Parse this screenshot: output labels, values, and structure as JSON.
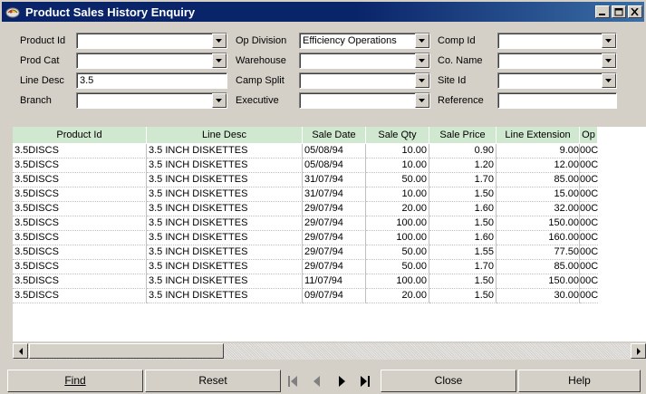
{
  "window": {
    "title": "Product Sales History Enquiry"
  },
  "form": {
    "product_id": {
      "label": "Product Id",
      "value": ""
    },
    "prod_cat": {
      "label": "Prod Cat",
      "value": ""
    },
    "line_desc": {
      "label": "Line Desc",
      "value": "3.5"
    },
    "branch": {
      "label": "Branch",
      "value": ""
    },
    "op_division": {
      "label": "Op Division",
      "value": "Efficiency Operations"
    },
    "warehouse": {
      "label": "Warehouse",
      "value": ""
    },
    "camp_split": {
      "label": "Camp Split",
      "value": ""
    },
    "executive": {
      "label": "Executive",
      "value": ""
    },
    "comp_id": {
      "label": "Comp Id",
      "value": ""
    },
    "co_name": {
      "label": "Co. Name",
      "value": ""
    },
    "site_id": {
      "label": "Site Id",
      "value": ""
    },
    "reference": {
      "label": "Reference",
      "value": ""
    }
  },
  "grid": {
    "columns": [
      "Product Id",
      "Line Desc",
      "Sale Date",
      "Sale Qty",
      "Sale Price",
      "Line Extension",
      "Op"
    ],
    "rows": [
      [
        "3.5DISCS",
        "3.5 INCH DISKETTES",
        "05/08/94",
        "10.00",
        "0.90",
        "9.00",
        "00C"
      ],
      [
        "3.5DISCS",
        "3.5 INCH DISKETTES",
        "05/08/94",
        "10.00",
        "1.20",
        "12.00",
        "00C"
      ],
      [
        "3.5DISCS",
        "3.5 INCH DISKETTES",
        "31/07/94",
        "50.00",
        "1.70",
        "85.00",
        "00C"
      ],
      [
        "3.5DISCS",
        "3.5 INCH DISKETTES",
        "31/07/94",
        "10.00",
        "1.50",
        "15.00",
        "00C"
      ],
      [
        "3.5DISCS",
        "3.5 INCH DISKETTES",
        "29/07/94",
        "20.00",
        "1.60",
        "32.00",
        "00C"
      ],
      [
        "3.5DISCS",
        "3.5 INCH DISKETTES",
        "29/07/94",
        "100.00",
        "1.50",
        "150.00",
        "00C"
      ],
      [
        "3.5DISCS",
        "3.5 INCH DISKETTES",
        "29/07/94",
        "100.00",
        "1.60",
        "160.00",
        "00C"
      ],
      [
        "3.5DISCS",
        "3.5 INCH DISKETTES",
        "29/07/94",
        "50.00",
        "1.55",
        "77.50",
        "00C"
      ],
      [
        "3.5DISCS",
        "3.5 INCH DISKETTES",
        "29/07/94",
        "50.00",
        "1.70",
        "85.00",
        "00C"
      ],
      [
        "3.5DISCS",
        "3.5 INCH DISKETTES",
        "11/07/94",
        "100.00",
        "1.50",
        "150.00",
        "00C"
      ],
      [
        "3.5DISCS",
        "3.5 INCH DISKETTES",
        "09/07/94",
        "20.00",
        "1.50",
        "30.00",
        "00C"
      ]
    ]
  },
  "buttons": {
    "find": "Find",
    "reset": "Reset",
    "close": "Close",
    "help": "Help"
  },
  "icons": {
    "app": "app-icon",
    "minimize": "minimize-icon",
    "maximize": "maximize-icon",
    "close": "close-icon",
    "first": "first-record-icon",
    "prev": "previous-record-icon",
    "next": "next-record-icon",
    "last": "last-record-icon"
  },
  "colors": {
    "titlebar": "#0a246a",
    "grid_header": "#cfe8cf"
  }
}
